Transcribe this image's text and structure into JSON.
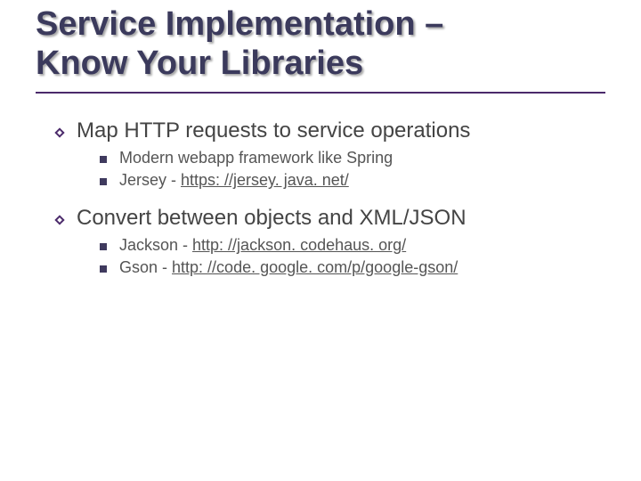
{
  "title_line1": "Service Implementation –",
  "title_line2": "Know Your Libraries",
  "sections": [
    {
      "heading": "Map HTTP requests to service operations",
      "items": [
        {
          "text": "Modern webapp framework like Spring"
        },
        {
          "prefix": "Jersey - ",
          "link_text": "https: //jersey. java. net/"
        }
      ]
    },
    {
      "heading": "Convert between objects and XML/JSON",
      "items": [
        {
          "prefix": "Jackson - ",
          "link_text": "http: //jackson. codehaus. org/"
        },
        {
          "prefix": "Gson - ",
          "link_text": "http: //code. google. com/p/google-gson/"
        }
      ]
    }
  ]
}
